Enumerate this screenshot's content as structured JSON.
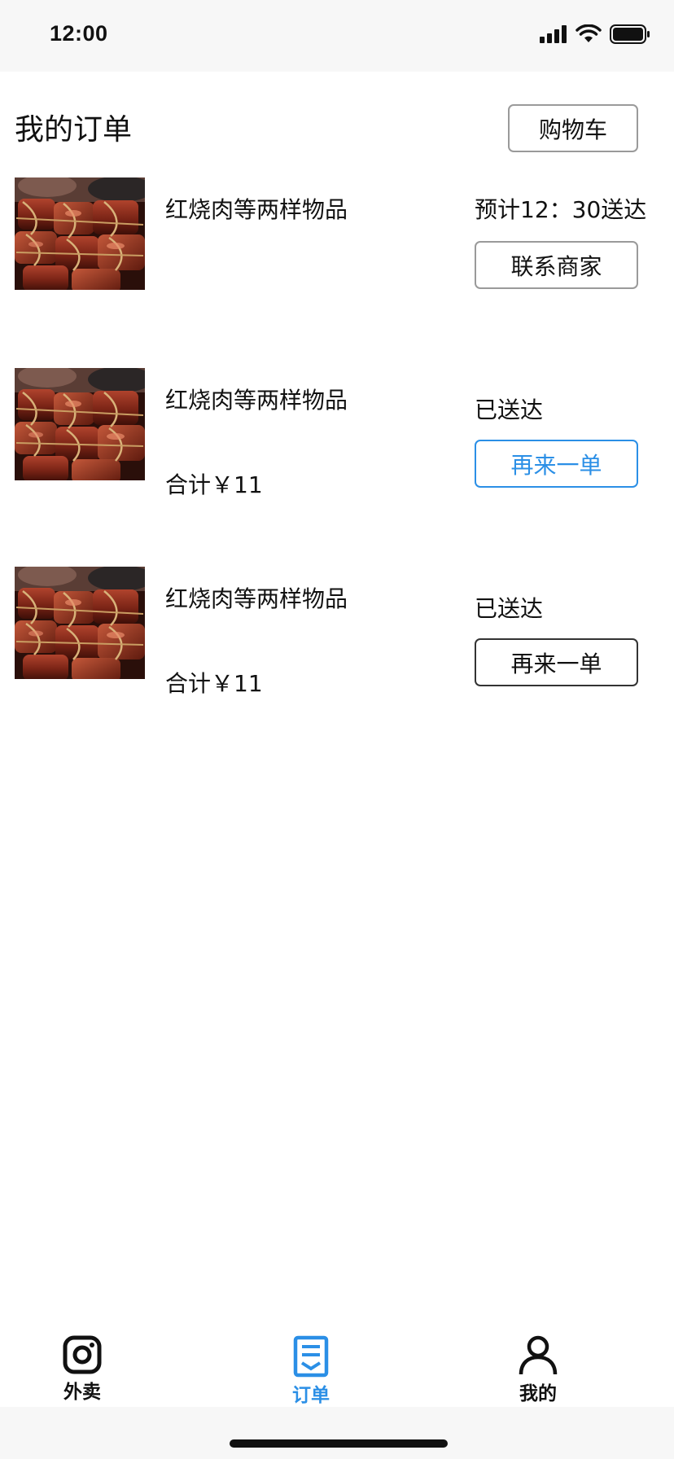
{
  "status_bar": {
    "time": "12:00"
  },
  "header": {
    "title": "我的订单",
    "cart_button": "购物车"
  },
  "orders": [
    {
      "item_name": "红烧肉等两样物品",
      "total": "",
      "status": "预计12：30送达",
      "action": "联系商家"
    },
    {
      "item_name": "红烧肉等两样物品",
      "total": "合计￥11",
      "status": "已送达",
      "action": "再来一单"
    },
    {
      "item_name": "红烧肉等两样物品",
      "total": "合计￥11",
      "status": "已送达",
      "action": "再来一单"
    }
  ],
  "tab_bar": {
    "tabs": [
      {
        "label": "外卖",
        "icon": "instagram-camera-icon"
      },
      {
        "label": "订单",
        "icon": "order-receipt-icon",
        "active": true
      },
      {
        "label": "我的",
        "icon": "person-icon"
      }
    ]
  },
  "colors": {
    "accent": "#2b8fe6",
    "text": "#111111",
    "border": "#9a9a9a",
    "status_bg": "#f7f7f7"
  }
}
